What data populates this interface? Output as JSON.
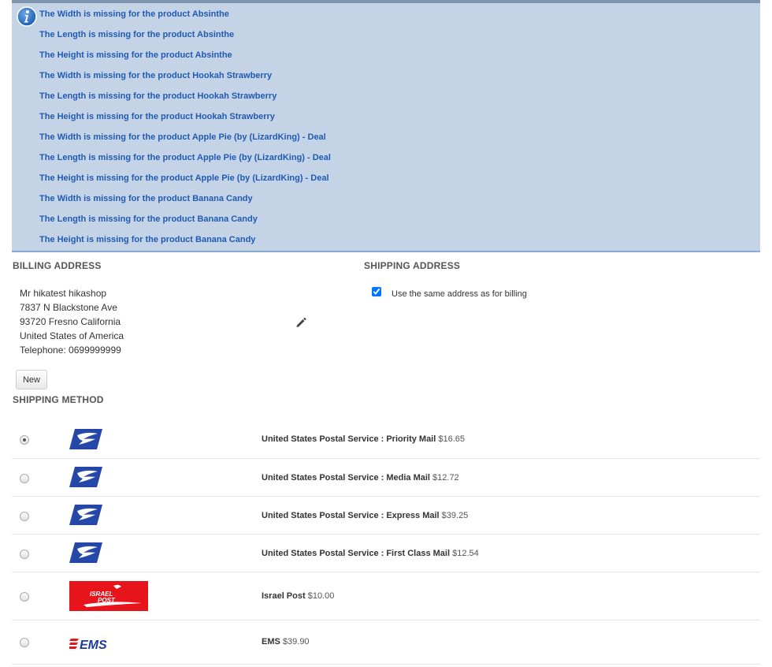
{
  "notice": {
    "messages": [
      "The Width is missing for the product Absinthe",
      "The Length is missing for the product Absinthe",
      "The Height is missing for the product Absinthe",
      "The Width is missing for the product Hookah Strawberry",
      "The Length is missing for the product Hookah Strawberry",
      "The Height is missing for the product Hookah Strawberry",
      "The Width is missing for the product Apple Pie (by (LizardKing) - Deal",
      "The Length is missing for the product Apple Pie (by (LizardKing) - Deal",
      "The Height is missing for the product Apple Pie (by (LizardKing) - Deal",
      "The Width is missing for the product Banana Candy",
      "The Length is missing for the product Banana Candy",
      "The Height is missing for the product Banana Candy"
    ],
    "icon": "info-icon",
    "background": "#c5d3e6",
    "text_color": "#1f5bb5"
  },
  "billing": {
    "title": "BILLING ADDRESS",
    "lines": [
      "Mr hikatest hikashop",
      "7837 N Blackstone Ave",
      "93720 Fresno California",
      "United States of America",
      "Telephone: 0699999999"
    ],
    "edit_icon": "pencil-icon",
    "new_label": "New"
  },
  "shipping": {
    "title": "SHIPPING ADDRESS",
    "same_address_label": "Use the same address as for billing",
    "same_address_checked": true
  },
  "method": {
    "title": "SHIPPING METHOD",
    "options": [
      {
        "name": "United States Postal Service : Priority Mail",
        "price": "$16.65",
        "logo": "usps-logo",
        "selected": true
      },
      {
        "name": "United States Postal Service : Media Mail",
        "price": "$12.72",
        "logo": "usps-logo",
        "selected": false
      },
      {
        "name": "United States Postal Service : Express Mail",
        "price": "$39.25",
        "logo": "usps-logo",
        "selected": false
      },
      {
        "name": "United States Postal Service : First Class Mail",
        "price": "$12.54",
        "logo": "usps-logo",
        "selected": false
      },
      {
        "name": "Israel Post",
        "price": "$10.00",
        "logo": "israel-post-logo",
        "logo_text": [
          "ISRAEL",
          "POST"
        ],
        "selected": false
      },
      {
        "name": "EMS",
        "price": "$39.90",
        "logo": "ems-logo",
        "logo_text": [
          "EMS"
        ],
        "selected": false
      }
    ]
  }
}
